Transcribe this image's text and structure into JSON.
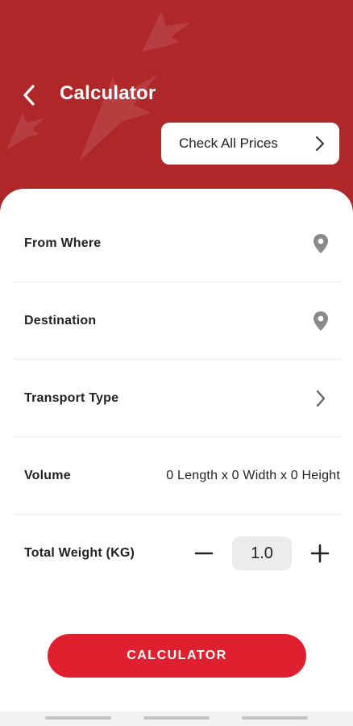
{
  "header": {
    "title": "Calculator",
    "check_prices_label": "Check All Prices"
  },
  "form": {
    "from_label": "From Where",
    "destination_label": "Destination",
    "transport_label": "Transport Type",
    "volume_label": "Volume",
    "volume_value": "0 Length x 0 Width x 0 Height",
    "weight_label": "Total Weight (KG)",
    "weight_value": "1.0"
  },
  "actions": {
    "calculate_label": "CALCULATOR"
  },
  "colors": {
    "header_bg": "#b0272a",
    "button_red": "#e0202f",
    "icon_gray": "#8a8a8a"
  }
}
